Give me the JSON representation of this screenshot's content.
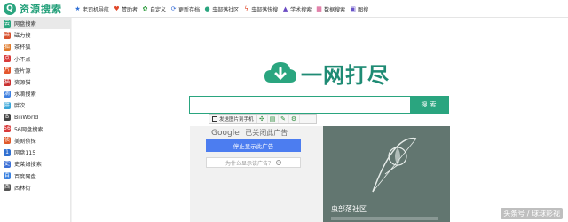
{
  "header": {
    "logo_mark": "Q",
    "logo_text": "资源搜索",
    "nav": [
      {
        "label": "老司机导航",
        "icon": "star-icon",
        "color": "#2e6fd6",
        "glyph": "★"
      },
      {
        "label": "赞助者",
        "icon": "heart-icon",
        "color": "#e0482a",
        "glyph": "♥"
      },
      {
        "label": "自定义",
        "icon": "leaf-icon",
        "color": "#2c9b3c",
        "glyph": "✿"
      },
      {
        "label": "更新存档",
        "icon": "refresh-icon",
        "color": "#3a6fd6",
        "glyph": "⟳"
      },
      {
        "label": "虫部落社区",
        "icon": "bug-icon",
        "color": "#2aa57f",
        "glyph": "●"
      },
      {
        "label": "虫部落快搜",
        "icon": "bolt-icon",
        "color": "#e0482a",
        "glyph": "ϟ"
      },
      {
        "label": "学术搜索",
        "icon": "graduation-cap-icon",
        "color": "#6a4bc2",
        "glyph": "▲"
      },
      {
        "label": "数据搜索",
        "icon": "chart-icon",
        "color": "#d23b7a",
        "glyph": "▦"
      },
      {
        "label": "图搜",
        "icon": "image-icon",
        "color": "#6a55c9",
        "glyph": "▣"
      }
    ]
  },
  "sidebar": {
    "items": [
      {
        "label": "网盘搜索",
        "icon": "cloud-search-icon",
        "color": "#2aa57f",
        "glyph": "云",
        "active": true
      },
      {
        "label": "磁力搜",
        "icon": "magnet-icon",
        "color": "#d7502c",
        "glyph": "磁"
      },
      {
        "label": "茶杯狐",
        "icon": "fox-icon",
        "color": "#e07a2a",
        "glyph": "狐"
      },
      {
        "label": "小不点",
        "icon": "dot-icon",
        "color": "#d83a3a",
        "glyph": "点"
      },
      {
        "label": "查片源",
        "icon": "film-icon",
        "color": "#e4572e",
        "glyph": "片"
      },
      {
        "label": "资源猫",
        "icon": "cat-icon",
        "color": "#c93030",
        "glyph": "猫"
      },
      {
        "label": "水滴搜索",
        "icon": "water-drop-icon",
        "color": "#3d7fe0",
        "glyph": "滴"
      },
      {
        "label": "胖次",
        "icon": "leaf-icon",
        "color": "#39a6d9",
        "glyph": "胖"
      },
      {
        "label": "BiliWorld",
        "icon": "bili-icon",
        "color": "#444444",
        "glyph": "B"
      },
      {
        "label": "56网盘搜索",
        "icon": "pan56-icon",
        "color": "#d93a3a",
        "glyph": "56"
      },
      {
        "label": "美剧侦探",
        "icon": "detective-icon",
        "color": "#e05a2a",
        "glyph": "侦"
      },
      {
        "label": "网盘115",
        "icon": "pan115-icon",
        "color": "#2f6fd0",
        "glyph": "1"
      },
      {
        "label": "史莱姆搜索",
        "icon": "slime-icon",
        "color": "#3b6fd6",
        "glyph": "史"
      },
      {
        "label": "百度网盘",
        "icon": "baidu-pan-icon",
        "color": "#3b82e0",
        "glyph": "百"
      },
      {
        "label": "西林街",
        "icon": "street-icon",
        "color": "#555555",
        "glyph": "西"
      }
    ]
  },
  "main": {
    "brand_text": "一网打尽",
    "search_placeholder": "",
    "search_button_label": "搜索",
    "ad_toolbar": {
      "send_label": "发送图片到手机"
    },
    "google_ad": {
      "google_label": "Google",
      "closed_label": "已关闭此广告",
      "stop_label": "停止显示此广告",
      "why_label": "为什么显示该广告？"
    },
    "banner": {
      "title": "虫部落社区"
    },
    "watermark": "头条号 / 球球影视"
  },
  "colors": {
    "accent": "#2aa57f",
    "google_blue": "#4c7df0",
    "banner_bg": "#627670"
  }
}
